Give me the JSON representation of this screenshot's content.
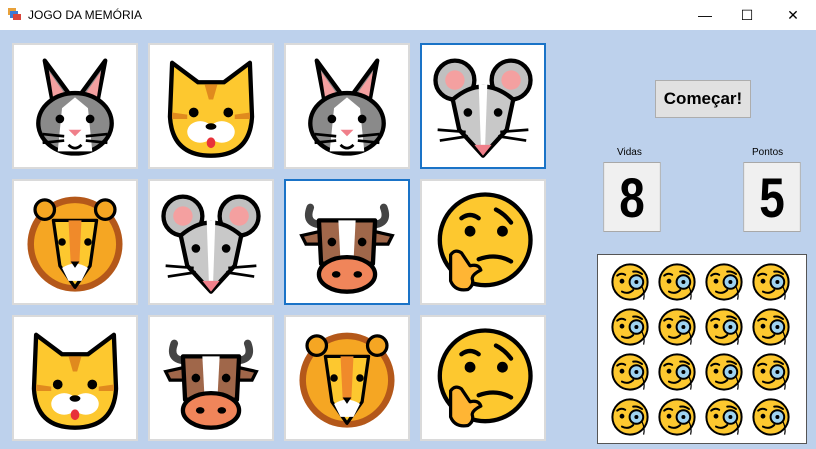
{
  "window": {
    "title": "JOGO DA MEMÓRIA",
    "controls": {
      "minimize": "—",
      "maximize": "☐",
      "close": "✕"
    }
  },
  "board": {
    "cards": [
      {
        "icon": "rabbit-face-icon",
        "selected": false
      },
      {
        "icon": "cat-face-icon",
        "selected": false
      },
      {
        "icon": "rabbit-face-icon",
        "selected": false
      },
      {
        "icon": "mouse-face-icon",
        "selected": true
      },
      {
        "icon": "lion-face-icon",
        "selected": false
      },
      {
        "icon": "mouse-face-icon",
        "selected": false
      },
      {
        "icon": "cow-face-icon",
        "selected": true
      },
      {
        "icon": "thinking-face-icon",
        "selected": false
      },
      {
        "icon": "cat-face-icon",
        "selected": false
      },
      {
        "icon": "cow-face-icon",
        "selected": false
      },
      {
        "icon": "lion-face-icon",
        "selected": false
      },
      {
        "icon": "thinking-face-icon",
        "selected": false
      }
    ]
  },
  "controls": {
    "start_label": "Começar!"
  },
  "score": {
    "lives_label": "Vidas",
    "lives_value": "8",
    "points_label": "Pontos",
    "points_value": "5"
  },
  "lives_panel": {
    "icon": "monocle-face-icon",
    "count": 16
  },
  "colors": {
    "background": "#bdd1ec",
    "selected_border": "#1a73c7"
  }
}
